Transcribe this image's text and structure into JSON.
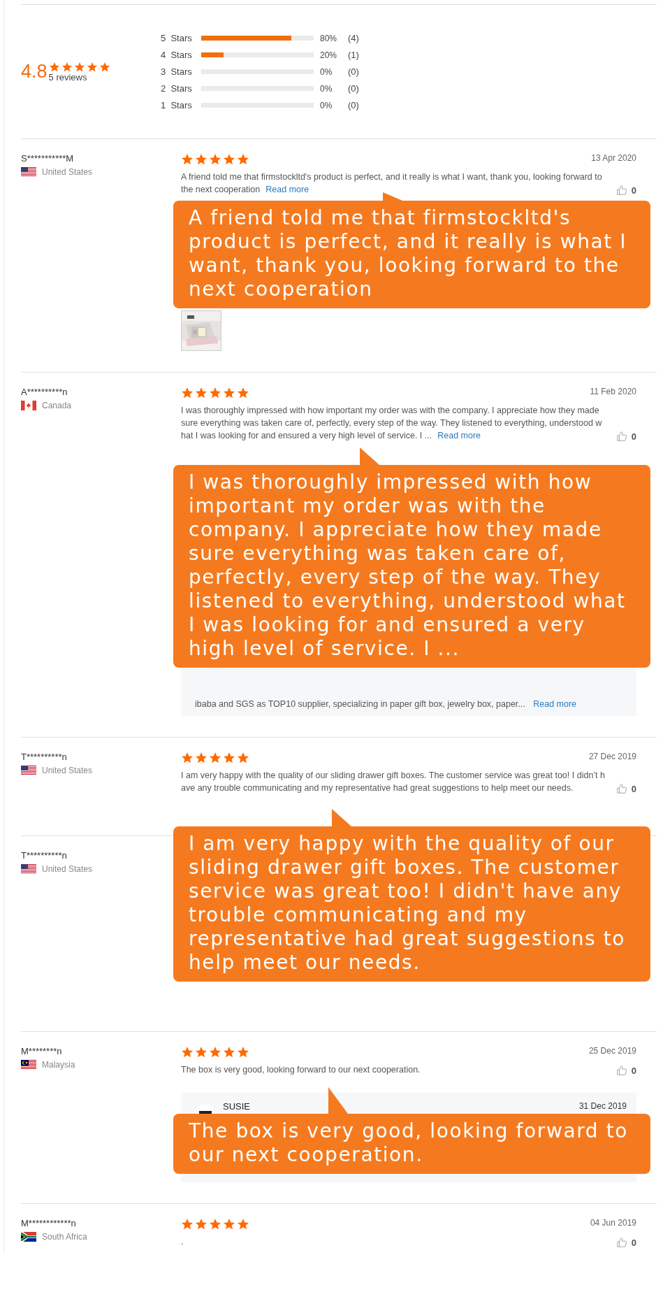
{
  "summary": {
    "score": "4.8",
    "stars": 5,
    "count": "5 reviews",
    "breakdown": [
      {
        "label": "5  Stars",
        "level": 0.8,
        "percent": "80%",
        "count": "(4)"
      },
      {
        "label": "4  Stars",
        "level": 0.2,
        "percent": "20%",
        "count": "(1)"
      },
      {
        "label": "3  Stars",
        "level": 0,
        "percent": "0%",
        "count": "(0)"
      },
      {
        "label": "2  Stars",
        "level": 0,
        "percent": "0%",
        "count": "(0)"
      },
      {
        "label": "1  Stars",
        "level": 0,
        "percent": "0%",
        "count": "(0)"
      }
    ]
  },
  "reviews": [
    {
      "reviewer": "S***********M",
      "country": "United States",
      "kind": "us",
      "stars": 5,
      "date": "13 Apr 2020",
      "text": "A friend told me that firmstockltd's product is perfect, and it really is what I want, thank you, looking forward to the next cooperation",
      "read_more": "Read more",
      "likes": "0",
      "photos": [
        {
          "kind": "picture"
        }
      ],
      "callout": "A friend told me that firmstockltd's product is perfect, and it really is what I want, thank you, looking forward to the next cooperation"
    },
    {
      "reviewer": "A**********n",
      "country": "Canada",
      "kind": "ca",
      "stars": 5,
      "date": "11 Feb 2020",
      "text": "I was thoroughly impressed with how important my order was with the company. I appreciate how they made sure everything was taken care of, perfectly, every step of the way. They listened to everything, understood what I was looking for and ensured a very high level of service. I ...",
      "read_more": "Read more",
      "likes": "0",
      "reply": {
        "text": "ibaba and SGS as TOP10 supplier, specializing in paper gift box, jewelry box, paper...",
        "read_more": "Read more"
      },
      "callout": "I was thoroughly impressed with how important my order was with the company. I appreciate how they made sure everything was taken care of, perfectly, every step of the way. They listened to everything, understood what I was looking for and ensured a very high level of service. I ..."
    },
    {
      "reviewer": "T**********n",
      "country": "United States",
      "kind": "us",
      "stars": 5,
      "date": "27 Dec 2019",
      "text": "I am very happy with the quality of our sliding drawer gift boxes. The customer service was great too! I didn’t have any trouble communicating and my representative had great suggestions to help meet our needs.",
      "likes": "0",
      "callout": "I am very happy with the quality of our sliding drawer gift boxes. The customer service was great too! I didn't have any trouble communicating and my representative had great suggestions to help meet our needs."
    },
    {
      "reviewer": "T**********n",
      "country": "United States",
      "kind": "us"
    },
    {
      "reviewer": "M********n",
      "country": "Malaysia",
      "kind": "my",
      "stars": 5,
      "date": "25 Dec 2019",
      "text": "The box is very good, looking forward to our next cooperation.",
      "likes": "0",
      "reply": {
        "name": "SUSIE",
        "date": "31 Dec 2019"
      },
      "callout": "The box is very good, looking forward to our next cooperation."
    },
    {
      "reviewer": "M************n",
      "country": "South Africa",
      "kind": "za",
      "stars": 5,
      "date": "04 Jun 2019",
      "text": ".",
      "likes": "0"
    }
  ]
}
